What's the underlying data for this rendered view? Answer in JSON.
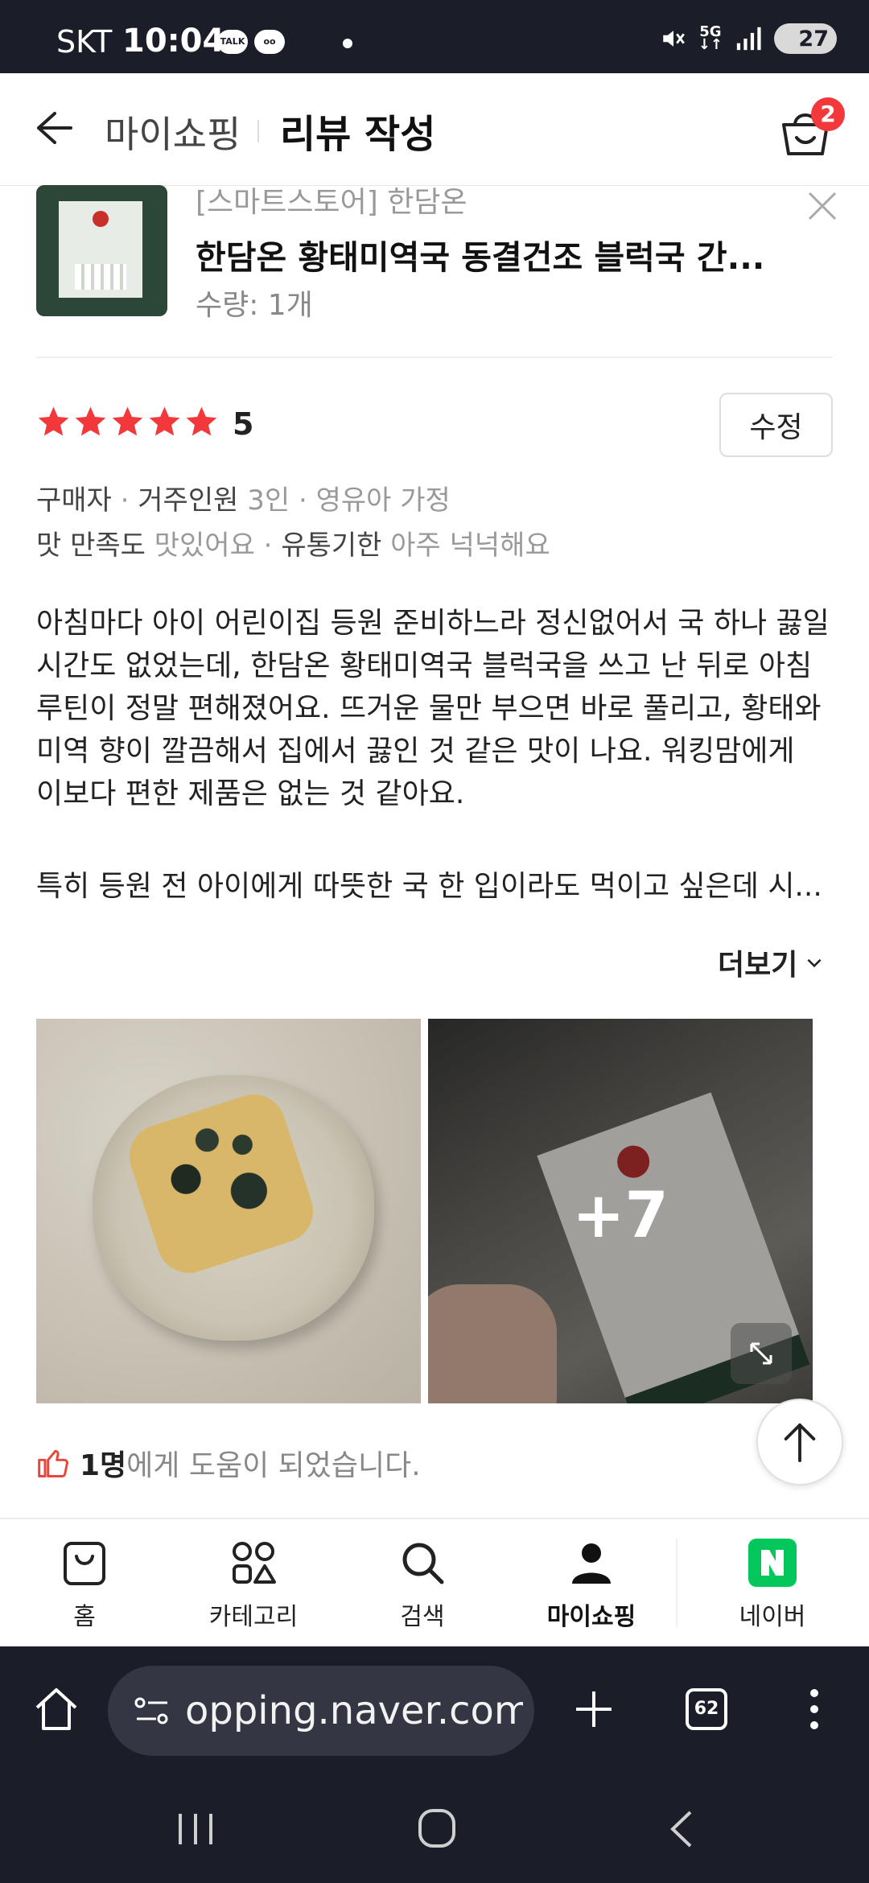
{
  "status_bar": {
    "carrier": "SKT",
    "time": "10:04",
    "talk_icon_label": "TALK",
    "network": "5G",
    "battery": "27"
  },
  "header": {
    "breadcrumb": "마이쇼핑",
    "title": "리뷰 작성",
    "cart_count": "2"
  },
  "product": {
    "store": "[스마트스토어] 한담온",
    "name": "한담온 황태미역국 동결건조 블럭국 간...",
    "quantity": "수량: 1개"
  },
  "review": {
    "rating": "5",
    "edit_label": "수정",
    "meta1": {
      "label": "구매자",
      "k1": "거주인원",
      "v1": "3인",
      "v2": "영유아 가정"
    },
    "meta2": {
      "k1": "맛 만족도",
      "v1": "맛있어요",
      "k2": "유통기한",
      "v2": "아주 넉넉해요"
    },
    "body": "아침마다 아이 어린이집 등원 준비하느라 정신없어서 국 하나 끓일 시간도 없었는데, 한담온 황태미역국 블럭국을 쓰고 난 뒤로 아침 루틴이 정말 편해졌어요. 뜨거운 물만 부으면 바로 풀리고, 황태와 미역 향이 깔끔해서 집에서 끓인 것 같은 맛이 나요. 워킹맘에게 이보다 편한 제품은 없는 것 같아요.",
    "body_more": "특히 등원 전 아이에게 따뜻한 국 한 입이라도 먹이고 싶은데 시...",
    "more_label": "더보기",
    "photo_more": "+7",
    "helpful_count": "1명",
    "helpful_text": "에게 도움이 되었습니다."
  },
  "tabs": [
    {
      "label": "홈",
      "icon": "bag-icon"
    },
    {
      "label": "카테고리",
      "icon": "category-icon"
    },
    {
      "label": "검색",
      "icon": "search-icon"
    },
    {
      "label": "마이쇼핑",
      "icon": "person-icon",
      "active": true
    },
    {
      "label": "네이버",
      "icon": "naver-icon"
    }
  ],
  "browser": {
    "url": "opping.naver.com",
    "tab_count": "62"
  },
  "colors": {
    "star": "#f2383a",
    "badge": "#f2383a",
    "naver_green": "#03c75a",
    "system_bar": "#1b1d29"
  }
}
